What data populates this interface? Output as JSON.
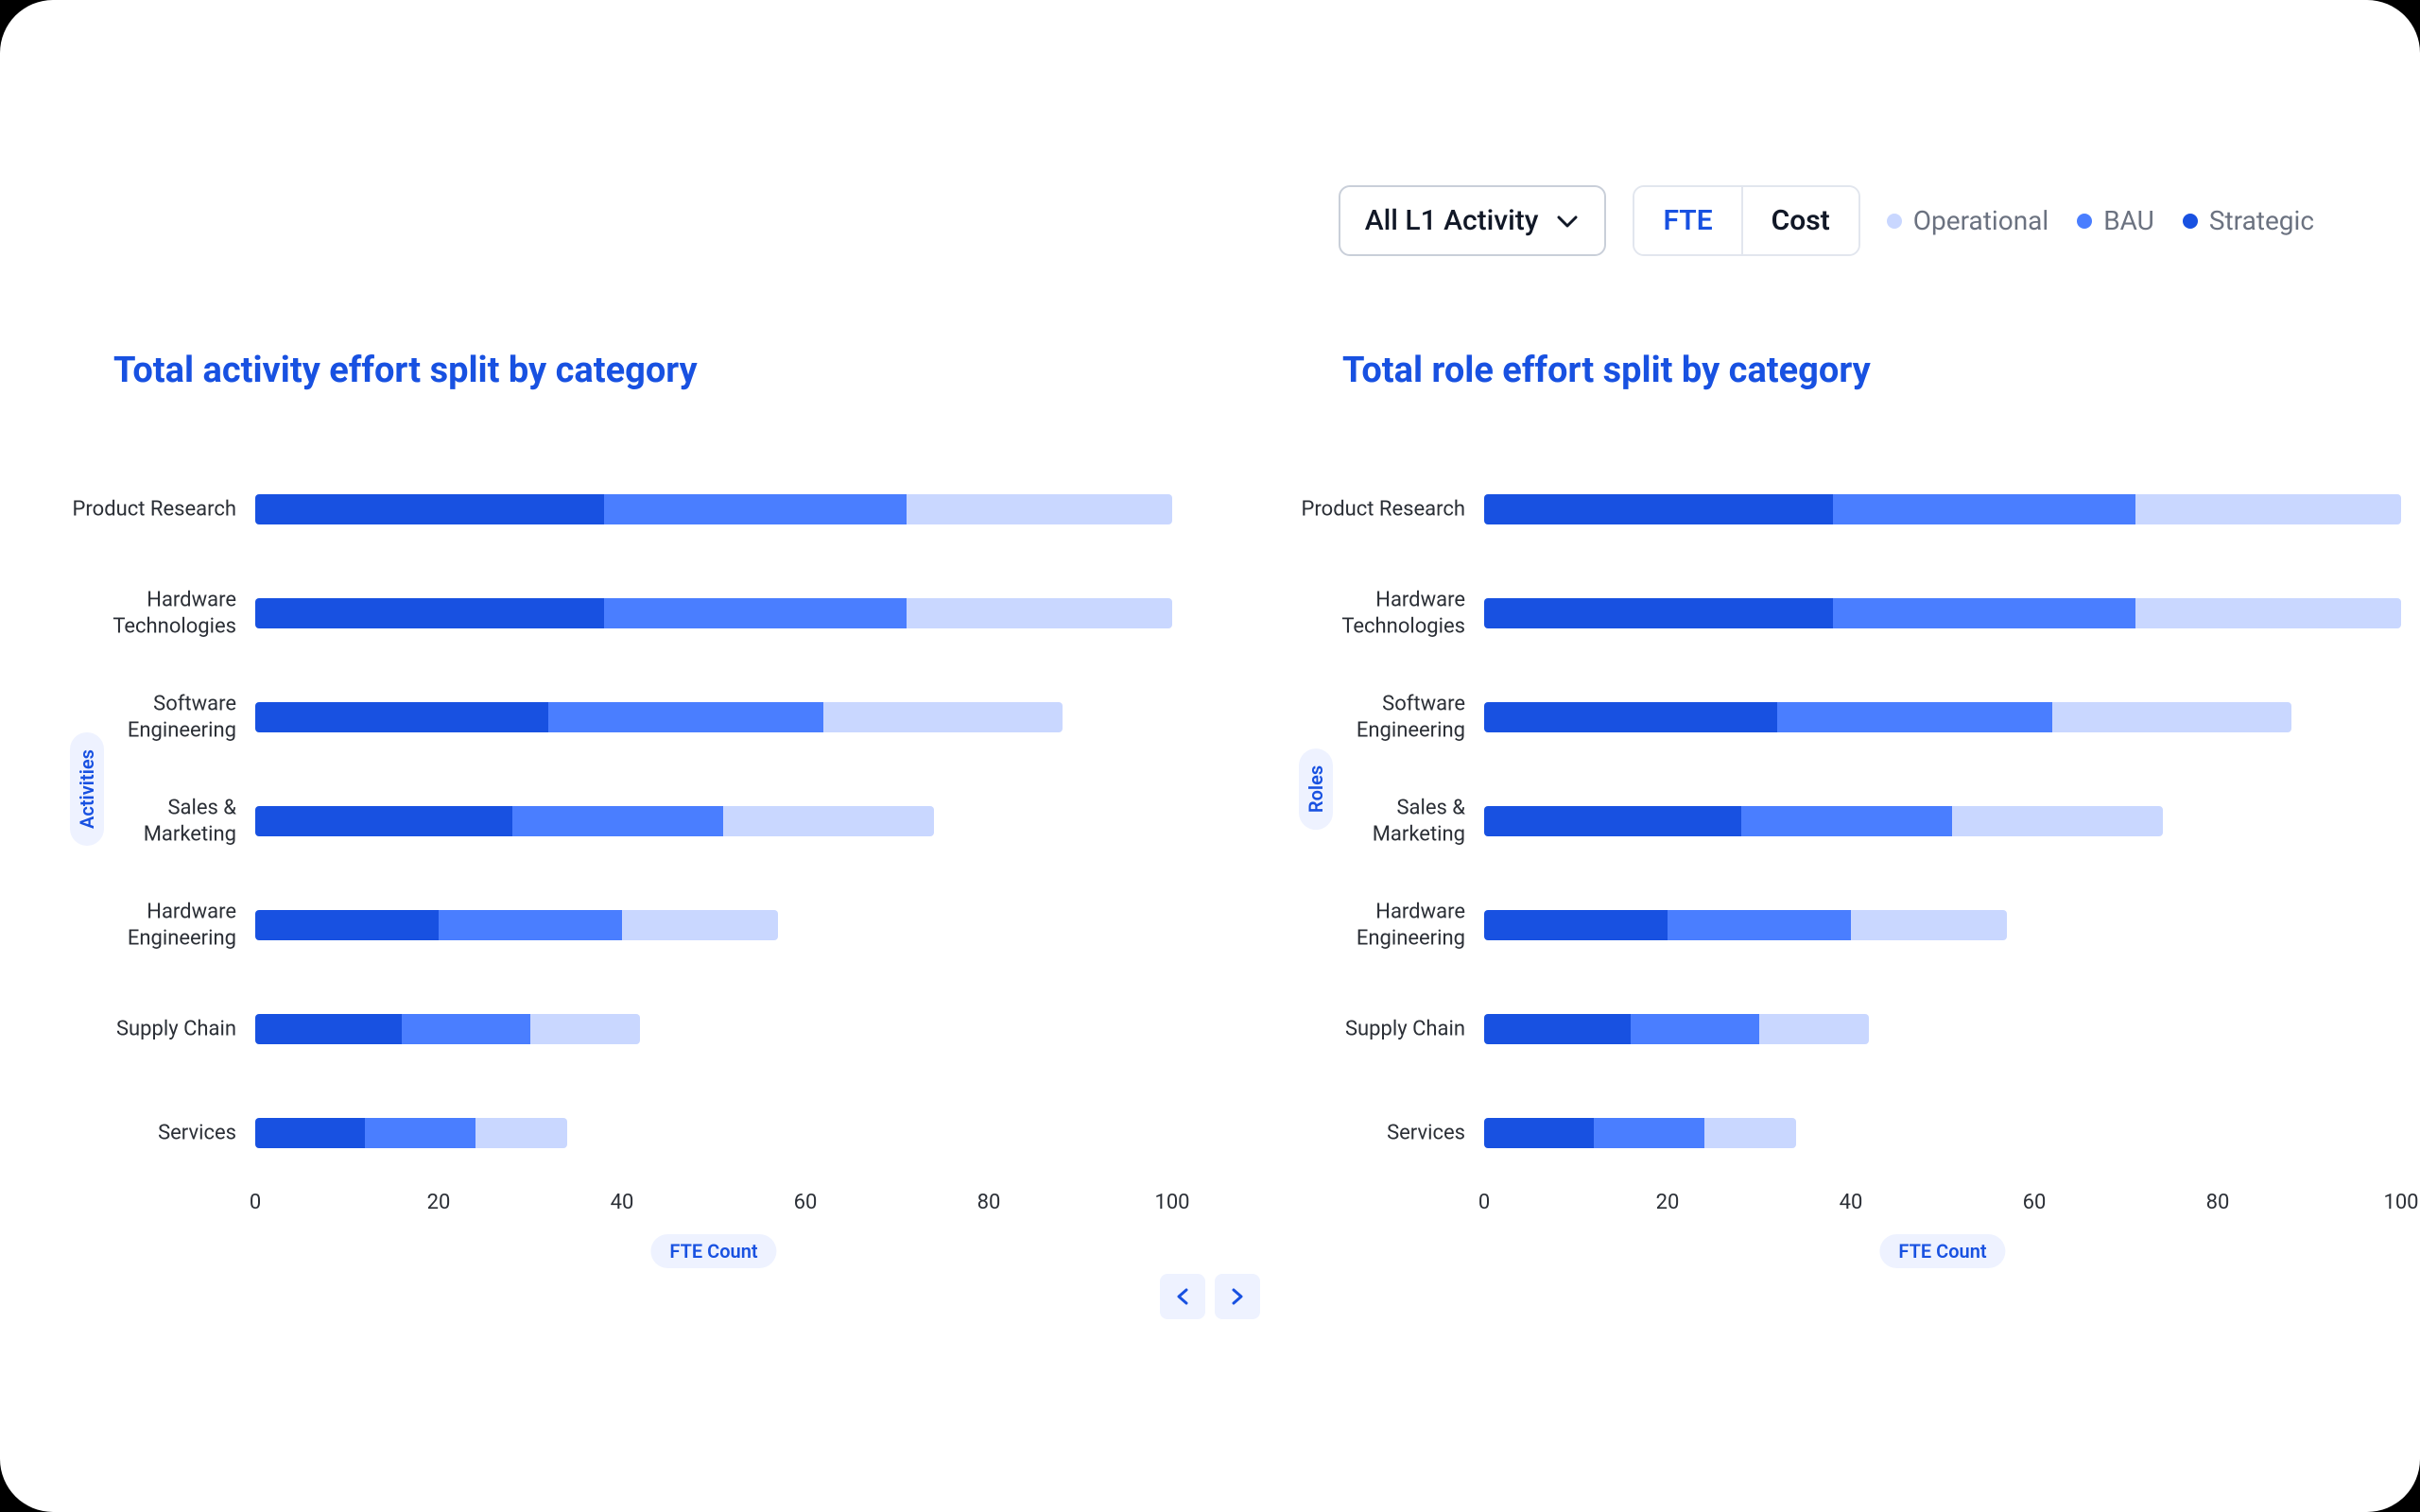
{
  "controls": {
    "filter": {
      "selected": "All L1 Activity"
    },
    "segments": {
      "fte": "FTE",
      "cost": "Cost",
      "active": "fte"
    },
    "legend": {
      "operational": "Operational",
      "bau": "BAU",
      "strategic": "Strategic"
    }
  },
  "colors": {
    "strategic": "#1851e1",
    "bau": "#4a7eff",
    "operational": "#c9d7ff"
  },
  "charts": {
    "left": {
      "title": "Total activity effort split by category",
      "ylabel": "Activities",
      "xlabel": "FTE Count"
    },
    "right": {
      "title": "Total role effort split by category",
      "ylabel": "Roles",
      "xlabel": "FTE Count"
    }
  },
  "chart_data": [
    {
      "type": "bar",
      "orientation": "horizontal",
      "stacked": true,
      "title": "Total activity effort split by category",
      "xlabel": "FTE Count",
      "ylabel": "Activities",
      "xlim": [
        0,
        100
      ],
      "xticks": [
        0,
        20,
        40,
        60,
        80,
        100
      ],
      "categories": [
        "Product Research",
        "Hardware\nTechnologies",
        "Software\nEngineering",
        "Sales &\nMarketing",
        "Hardware\nEngineering",
        "Supply Chain",
        "Services"
      ],
      "series": [
        {
          "name": "Strategic",
          "values": [
            38,
            38,
            32,
            28,
            20,
            16,
            12
          ]
        },
        {
          "name": "BAU",
          "values": [
            33,
            33,
            30,
            23,
            20,
            14,
            12
          ]
        },
        {
          "name": "Operational",
          "values": [
            29,
            29,
            26,
            23,
            17,
            12,
            10
          ]
        }
      ]
    },
    {
      "type": "bar",
      "orientation": "horizontal",
      "stacked": true,
      "title": "Total role effort split by category",
      "xlabel": "FTE Count",
      "ylabel": "Roles",
      "xlim": [
        0,
        100
      ],
      "xticks": [
        0,
        20,
        40,
        60,
        80,
        100
      ],
      "categories": [
        "Product Research",
        "Hardware\nTechnologies",
        "Software\nEngineering",
        "Sales &\nMarketing",
        "Hardware\nEngineering",
        "Supply Chain",
        "Services"
      ],
      "series": [
        {
          "name": "Strategic",
          "values": [
            38,
            38,
            32,
            28,
            20,
            16,
            12
          ]
        },
        {
          "name": "BAU",
          "values": [
            33,
            33,
            30,
            23,
            20,
            14,
            12
          ]
        },
        {
          "name": "Operational",
          "values": [
            29,
            29,
            26,
            23,
            17,
            12,
            10
          ]
        }
      ]
    }
  ]
}
